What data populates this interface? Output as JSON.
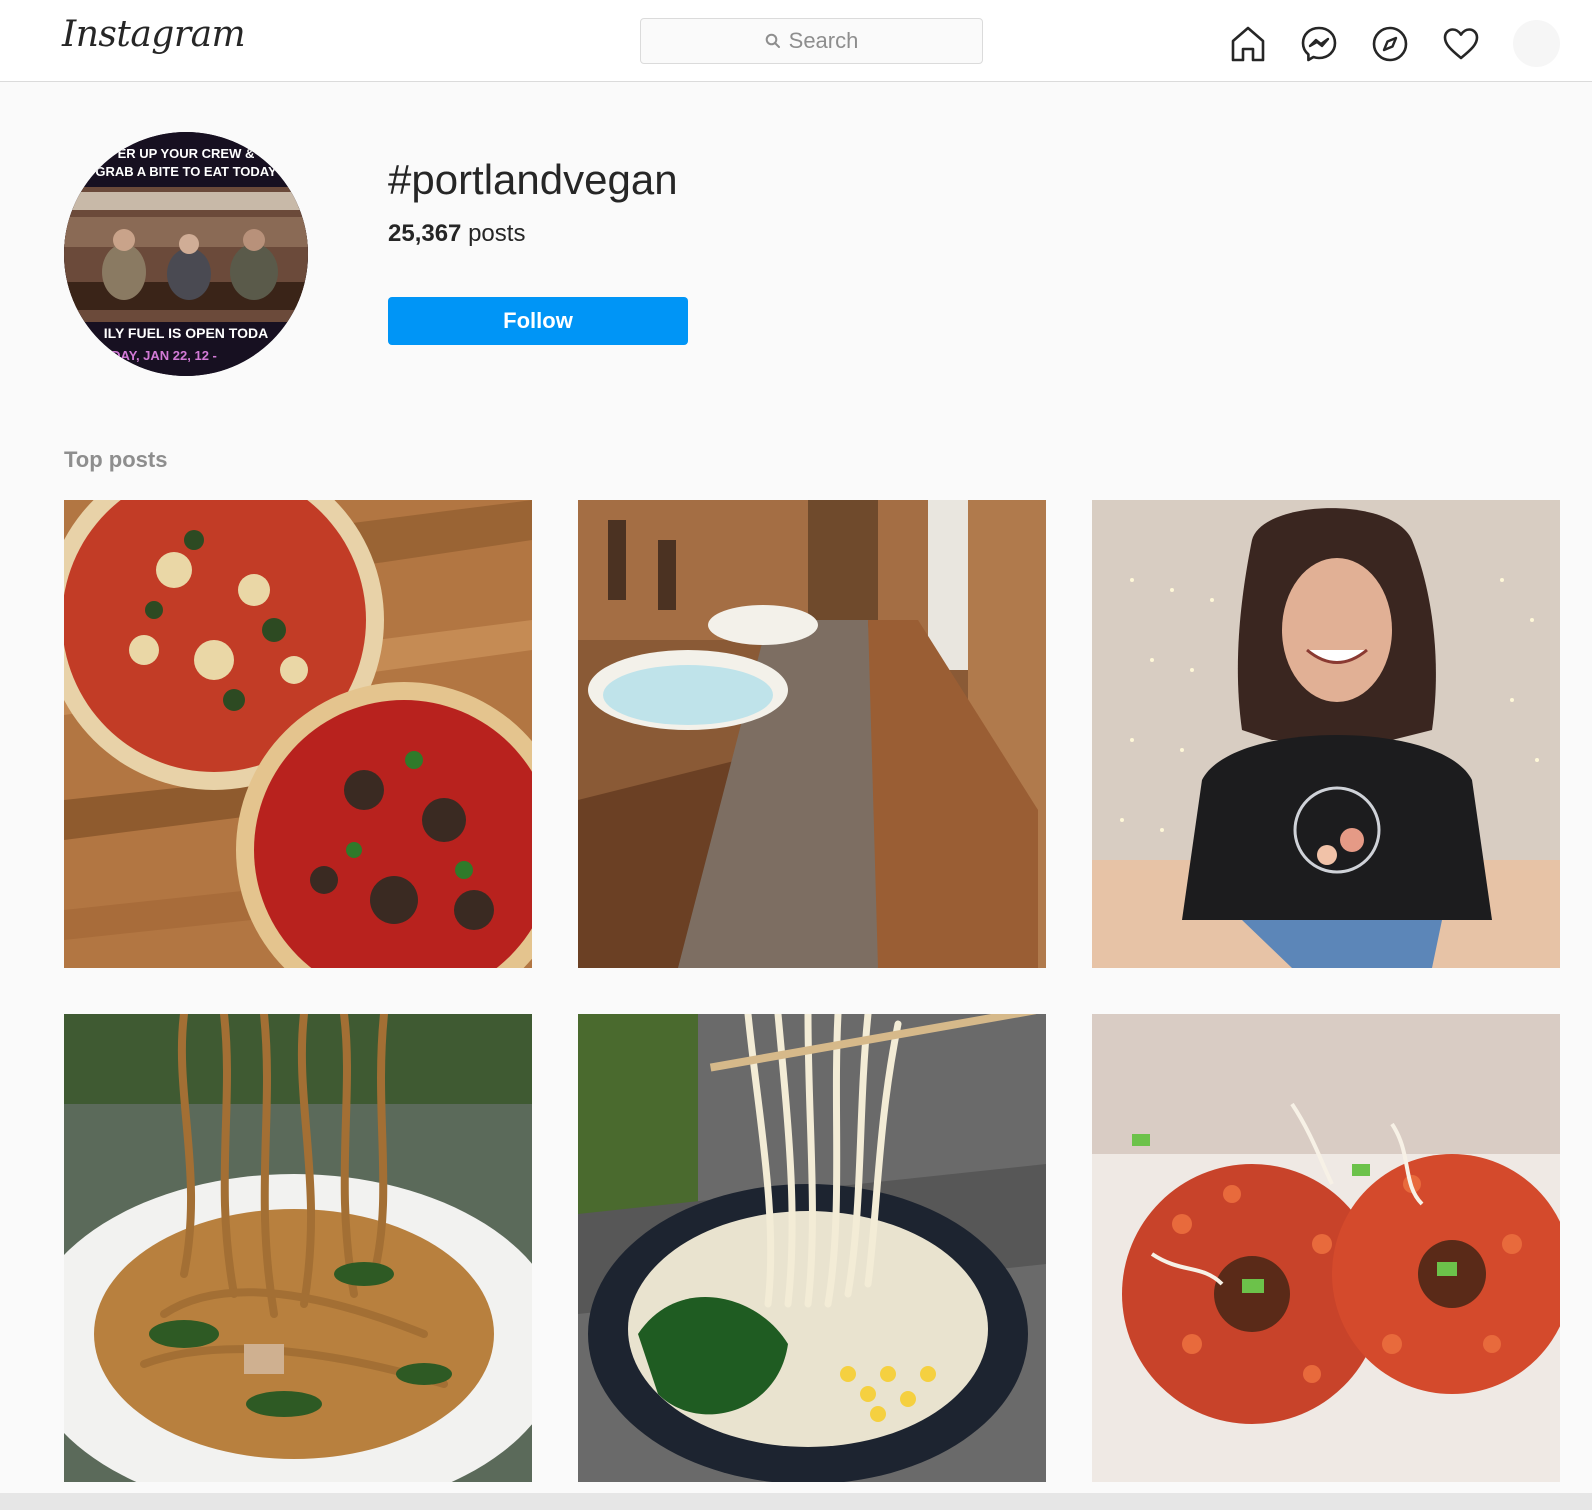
{
  "nav": {
    "logo": "Instagram",
    "search_placeholder": "Search",
    "icons": [
      "home-icon",
      "messenger-icon",
      "explore-icon",
      "heart-icon",
      "profile-avatar"
    ]
  },
  "header": {
    "hashtag": "#portlandvegan",
    "post_count": "25,367",
    "post_label": "posts",
    "follow_label": "Follow",
    "avatar_text_top_1": "ER UP YOUR CREW &",
    "avatar_text_top_2": "GRAB A BITE TO EAT TODAY",
    "avatar_text_bottom_1": "ILY FUEL IS OPEN TODA",
    "avatar_text_bottom_2": "DAY, JAN 22, 12 -"
  },
  "top_posts": {
    "label": "Top posts",
    "posts": [
      {
        "subject": "pizza-photo"
      },
      {
        "subject": "outdoor-bath-photo"
      },
      {
        "subject": "smiling-woman-photo"
      },
      {
        "subject": "noodles-photo"
      },
      {
        "subject": "ramen-bowl-photo"
      },
      {
        "subject": "fried-food-photo"
      }
    ]
  },
  "colors": {
    "accent": "#0095f6",
    "border": "#dbdbdb",
    "background": "#fafafa",
    "muted_text": "#8e8e8e"
  }
}
